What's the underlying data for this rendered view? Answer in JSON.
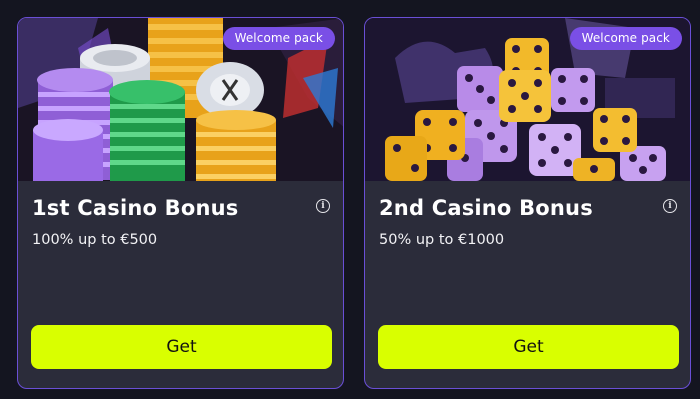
{
  "cards": [
    {
      "badge": "Welcome pack",
      "title": "1st Casino Bonus",
      "subtitle": "100% up to €500",
      "button_label": "Get",
      "image_icon": "casino-chips-image"
    },
    {
      "badge": "Welcome pack",
      "title": "2nd Casino Bonus",
      "subtitle": "50% up to €1000",
      "button_label": "Get",
      "image_icon": "dice-image"
    }
  ],
  "colors": {
    "background": "#141520",
    "card": "#2b2c3a",
    "card_border": "#6a4fd6",
    "badge": "#7a4fe6",
    "button": "#d9ff00"
  }
}
